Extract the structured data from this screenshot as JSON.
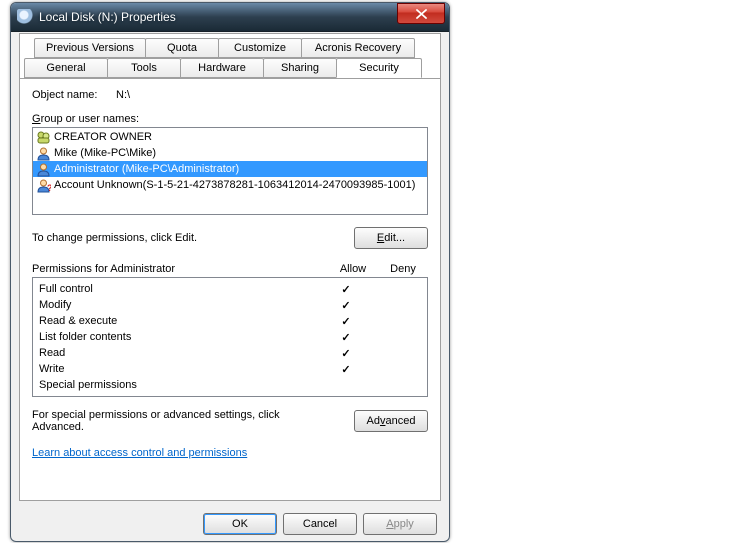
{
  "window": {
    "title": "Local Disk (N:) Properties"
  },
  "tabs_row1": [
    {
      "label": "Previous Versions"
    },
    {
      "label": "Quota"
    },
    {
      "label": "Customize"
    },
    {
      "label": "Acronis Recovery"
    }
  ],
  "tabs_row2": [
    {
      "label": "General"
    },
    {
      "label": "Tools"
    },
    {
      "label": "Hardware"
    },
    {
      "label": "Sharing"
    },
    {
      "label": "Security"
    }
  ],
  "active_tab": "Security",
  "object_name_label": "Object name:",
  "object_name_value": "N:\\",
  "group_label": "Group or user names:",
  "groups": [
    {
      "icon": "group",
      "text": "CREATOR OWNER",
      "selected": false
    },
    {
      "icon": "user",
      "text": "Mike (Mike-PC\\Mike)",
      "selected": false
    },
    {
      "icon": "user",
      "text": "Administrator (Mike-PC\\Administrator)",
      "selected": true
    },
    {
      "icon": "unknown",
      "text": "Account Unknown(S-1-5-21-4273878281-1063412014-2470093985-1001)",
      "selected": false
    }
  ],
  "edit_hint": "To change permissions, click Edit.",
  "edit_button": "Edit...",
  "perm_header_name": "Permissions for Administrator",
  "perm_header_allow": "Allow",
  "perm_header_deny": "Deny",
  "permissions": [
    {
      "name": "Full control",
      "allow": true,
      "deny": false
    },
    {
      "name": "Modify",
      "allow": true,
      "deny": false
    },
    {
      "name": "Read & execute",
      "allow": true,
      "deny": false
    },
    {
      "name": "List folder contents",
      "allow": true,
      "deny": false
    },
    {
      "name": "Read",
      "allow": true,
      "deny": false
    },
    {
      "name": "Write",
      "allow": true,
      "deny": false
    },
    {
      "name": "Special permissions",
      "allow": false,
      "deny": false
    }
  ],
  "adv_hint": "For special permissions or advanced settings, click Advanced.",
  "adv_button": "Advanced",
  "help_link": "Learn about access control and permissions",
  "footer": {
    "ok": "OK",
    "cancel": "Cancel",
    "apply": "Apply"
  }
}
